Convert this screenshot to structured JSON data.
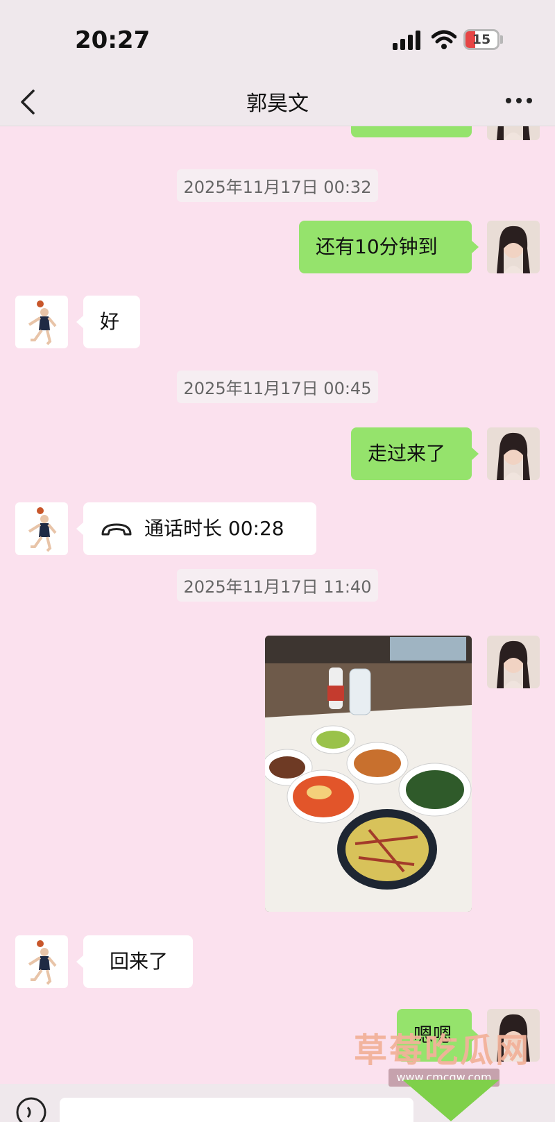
{
  "status_bar": {
    "time": "20:27",
    "battery": "15",
    "battery_color": "#e64545"
  },
  "header": {
    "title": "郭昊文",
    "back_icon": "chevron-left-icon",
    "more_icon": "ellipsis-icon"
  },
  "colors": {
    "background": "#fbe1ee",
    "outgoing_bubble": "#95e36c",
    "incoming_bubble": "#ffffff"
  },
  "messages": {
    "ts1": "2025年11月17日 00:32",
    "m1_out": "还有10分钟到",
    "m2_in": "好",
    "ts2": "2025年11月17日 00:45",
    "m3_out": "走过来了",
    "m4_call": "通话时长 00:28",
    "ts3": "2025年11月17日 11:40",
    "m6_in": "回来了",
    "m7_out": "嗯嗯"
  },
  "watermark": {
    "text": "草莓吃瓜网",
    "url": "www.cmcgw.com"
  }
}
